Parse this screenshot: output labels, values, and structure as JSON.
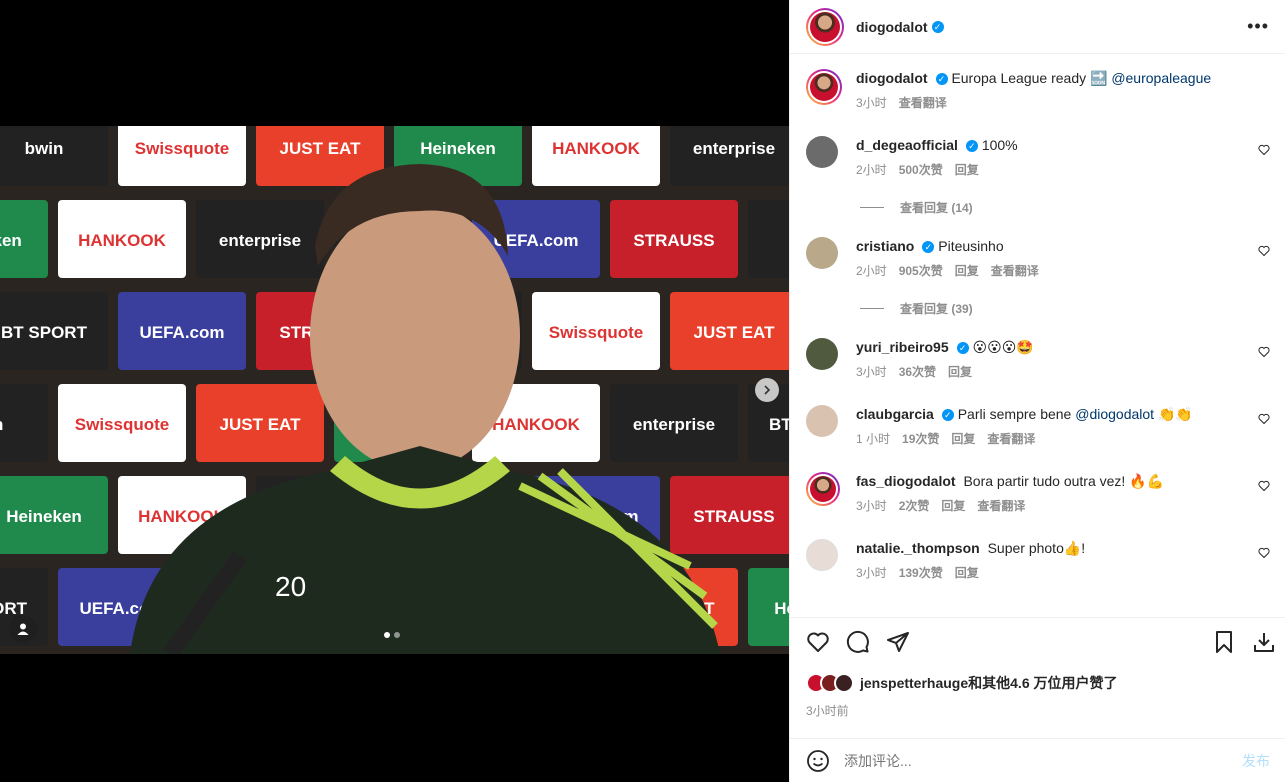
{
  "post": {
    "author": "diogodalot",
    "caption": "Europa League ready 🔜",
    "caption_mention": "@europaleague",
    "caption_time": "3小时",
    "caption_translate": "查看翻译"
  },
  "comments": [
    {
      "user": "d_degeaofficial",
      "verified": true,
      "text": "100%",
      "time": "2小时",
      "likes": "500次赞",
      "reply": "回复",
      "translate": "",
      "view_replies": "查看回复 (14)",
      "avatar_color": "#6b6b6b"
    },
    {
      "user": "cristiano",
      "verified": true,
      "text": "Piteusinho",
      "time": "2小时",
      "likes": "905次赞",
      "reply": "回复",
      "translate": "查看翻译",
      "view_replies": "查看回复 (39)",
      "avatar_color": "#b9a98a"
    },
    {
      "user": "yuri_ribeiro95",
      "verified": true,
      "text": "😮😮😮🤩",
      "time": "3小时",
      "likes": "36次赞",
      "reply": "回复",
      "translate": "",
      "view_replies": "",
      "avatar_color": "#4f5a3e"
    },
    {
      "user": "claubgarcia",
      "verified": true,
      "text": "Parli sempre bene",
      "mention": "@diogodalot",
      "text2": "👏👏",
      "time": "1 小时",
      "likes": "19次赞",
      "reply": "回复",
      "translate": "查看翻译",
      "view_replies": "",
      "avatar_color": "#d9c3b0"
    },
    {
      "user": "fas_diogodalot",
      "verified": false,
      "text": "Bora partir tudo outra vez! 🔥💪",
      "time": "3小时",
      "likes": "2次赞",
      "reply": "回复",
      "translate": "查看翻译",
      "view_replies": "",
      "avatar_color": "#c8102e"
    },
    {
      "user": "natalie._thompson",
      "verified": false,
      "text": "Super photo👍!",
      "time": "3小时",
      "likes": "139次赞",
      "reply": "回复",
      "translate": "",
      "view_replies": "",
      "avatar_color": "#e8ddd6"
    }
  ],
  "likes_summary": {
    "user": "jenspetterhauge",
    "rest": "和其他4.6 万位用户赞了"
  },
  "post_time": "3小时前",
  "add_comment": {
    "placeholder": "添加评论...",
    "post_label": "发布"
  },
  "photo": {
    "jersey_number": "20",
    "sponsor_texts": [
      "bwin",
      "Swissquote",
      "JUST EAT",
      "Heineken",
      "HANKOOK",
      "enterprise",
      "BT SPORT",
      "UEFA.com",
      "STRAUSS"
    ]
  },
  "colors": {
    "accent": "#0095f6",
    "link": "#00376b",
    "secondary_text": "#8e8e8e"
  }
}
